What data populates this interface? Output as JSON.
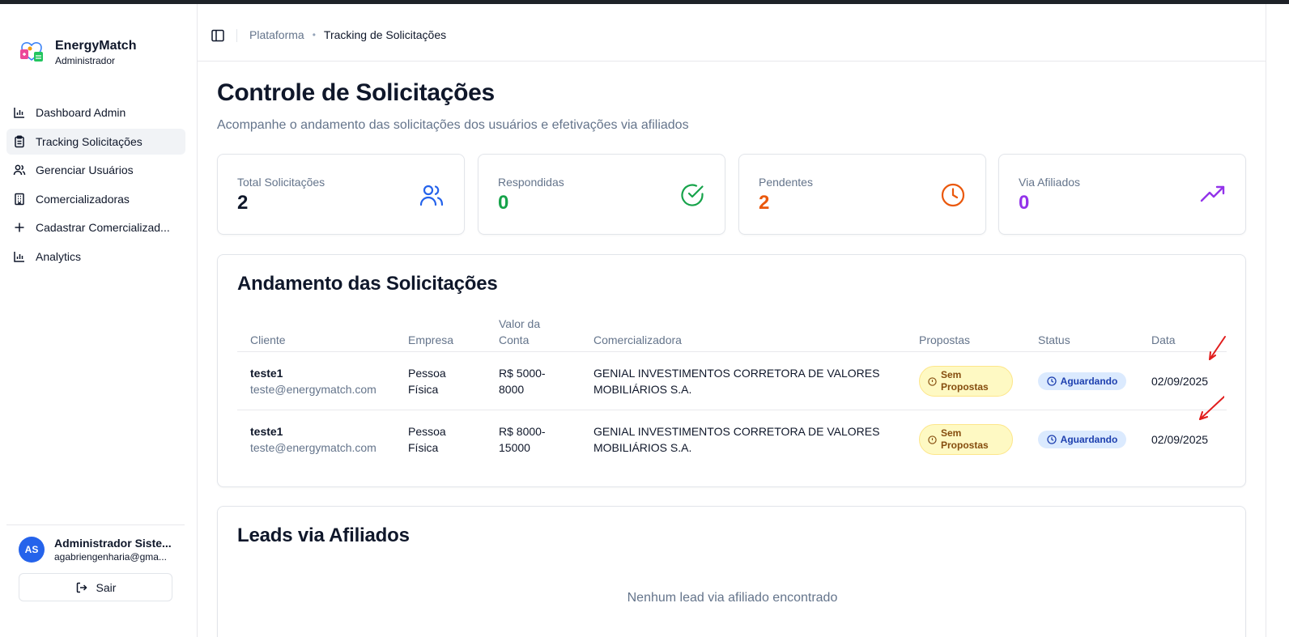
{
  "app": {
    "name": "EnergyMatch",
    "role": "Administrador"
  },
  "sidebar": {
    "items": [
      {
        "label": "Dashboard Admin",
        "icon": "bar-chart-icon",
        "active": false
      },
      {
        "label": "Tracking Solicitações",
        "icon": "clipboard-icon",
        "active": true
      },
      {
        "label": "Gerenciar Usuários",
        "icon": "users-icon",
        "active": false
      },
      {
        "label": "Comercializadoras",
        "icon": "building-icon",
        "active": false
      },
      {
        "label": "Cadastrar Comercializad...",
        "icon": "plus-icon",
        "active": false
      },
      {
        "label": "Analytics",
        "icon": "bar-chart-icon",
        "active": false
      }
    ]
  },
  "user": {
    "initials": "AS",
    "name": "Administrador Siste...",
    "email": "agabriengenharia@gma...",
    "logout_label": "Sair"
  },
  "header": {
    "breadcrumb_root": "Plataforma",
    "breadcrumb_current": "Tracking de Solicitações"
  },
  "page": {
    "title": "Controle de Solicitações",
    "subtitle": "Acompanhe o andamento das solicitações dos usuários e efetivações via afiliados"
  },
  "stats": [
    {
      "label": "Total Solicitações",
      "value": "2",
      "color": "#0f172a",
      "icon": "users-icon",
      "icon_color": "#2563eb"
    },
    {
      "label": "Respondidas",
      "value": "0",
      "color": "#16a34a",
      "icon": "check-circle-icon",
      "icon_color": "#16a34a"
    },
    {
      "label": "Pendentes",
      "value": "2",
      "color": "#ea580c",
      "icon": "clock-icon",
      "icon_color": "#ea580c"
    },
    {
      "label": "Via Afiliados",
      "value": "0",
      "color": "#9333ea",
      "icon": "trending-up-icon",
      "icon_color": "#9333ea"
    }
  ],
  "requests": {
    "title": "Andamento das Solicitações",
    "columns": [
      "Cliente",
      "Empresa",
      "Valor da Conta",
      "Comercializadora",
      "Propostas",
      "Status",
      "Data"
    ],
    "rows": [
      {
        "client": "teste1",
        "email": "teste@energymatch.com",
        "company": "Pessoa Física",
        "value": "R$ 5000-8000",
        "trader": "GENIAL INVESTIMENTOS CORRETORA DE VALORES MOBILIÁRIOS S.A.",
        "proposals": "Sem Propostas",
        "status": "Aguardando",
        "date": "02/09/2025"
      },
      {
        "client": "teste1",
        "email": "teste@energymatch.com",
        "company": "Pessoa Física",
        "value": "R$ 8000-15000",
        "trader": "GENIAL INVESTIMENTOS CORRETORA DE VALORES MOBILIÁRIOS S.A.",
        "proposals": "Sem Propostas",
        "status": "Aguardando",
        "date": "02/09/2025"
      }
    ]
  },
  "leads": {
    "title": "Leads via Afiliados",
    "empty": "Nenhum lead via afiliado encontrado"
  },
  "colors": {
    "annotation_arrow": "#e11d1d",
    "accent_blue": "#2563eb"
  }
}
